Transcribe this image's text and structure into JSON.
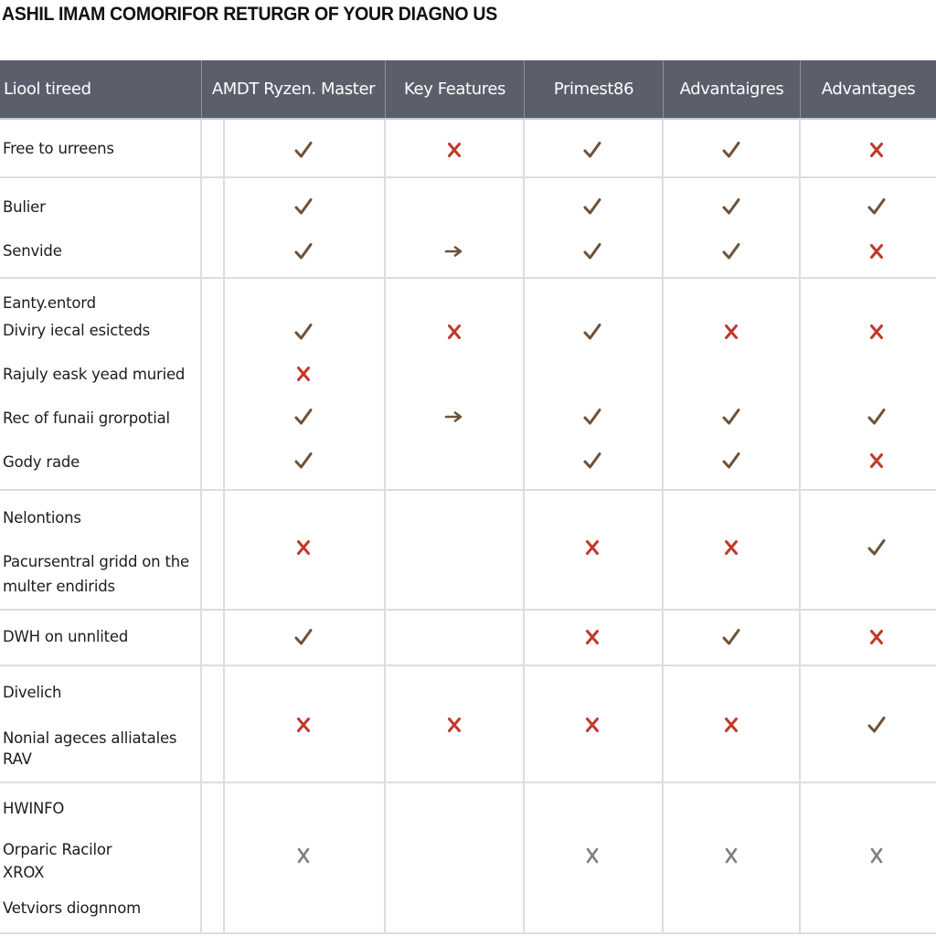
{
  "page": {
    "title": "ASHIL IMAM COMORIFOR RETURGR OF YOUR DIAGNO US"
  },
  "colors": {
    "header_bg": "#5a5f6b",
    "check": "#6e5238",
    "cross_red": "#c0392b",
    "cross_gray": "#7f7f7f",
    "arrow": "#6e5238",
    "grid_line": "#dcdde0"
  },
  "table": {
    "columns": [
      "Liool tireed",
      "AMDT Ryzen. Master",
      "Key Features",
      "Primest86",
      "Advantaigres",
      "Advantages"
    ],
    "groups": [
      {
        "labels": [
          "Free to urreens"
        ],
        "rows": [
          {
            "y": 0.5,
            "marks": [
              "check",
              "cross",
              "check",
              "check",
              "cross"
            ]
          }
        ]
      },
      {
        "labels": [
          "Bulier",
          "Senvide"
        ],
        "rows": [
          {
            "marks": [
              "check",
              "",
              "check",
              "check",
              "check"
            ]
          },
          {
            "marks": [
              "check",
              "arrow",
              "check",
              "check",
              "cross"
            ]
          }
        ]
      },
      {
        "labels": [
          "Eanty.entord",
          "Diviry iecal esicteds",
          "Rajuly eask yead muried",
          "Rec of funaii grorpotial",
          "Gody rade"
        ],
        "rows": [
          {
            "marks": [
              "check",
              "cross",
              "check",
              "cross",
              "cross"
            ]
          },
          {
            "marks": [
              "cross",
              "",
              "",
              "",
              ""
            ]
          },
          {
            "marks": [
              "check",
              "arrow",
              "check",
              "check",
              "check"
            ]
          },
          {
            "marks": [
              "check",
              "",
              "check",
              "check",
              "cross"
            ]
          }
        ]
      },
      {
        "labels": [
          "Nelontions",
          "Pacursentral gridd on the",
          "multer endirids"
        ],
        "rows": [
          {
            "marks": [
              "cross",
              "",
              "cross",
              "cross",
              "check"
            ]
          }
        ]
      },
      {
        "labels": [
          "DWH on unnlited"
        ],
        "rows": [
          {
            "marks": [
              "check",
              "",
              "cross",
              "check",
              "cross"
            ]
          }
        ]
      },
      {
        "labels": [
          "Divelich",
          "Nonial ageces alliatales",
          "RAV"
        ],
        "rows": [
          {
            "marks": [
              "cross",
              "cross",
              "cross",
              "cross",
              "check"
            ]
          }
        ]
      },
      {
        "labels": [
          "HWINFO",
          "Orparic Racilor",
          "XROX",
          "Vetviors diognnom"
        ],
        "rows": [
          {
            "marks": [
              "cross-gray",
              "",
              "cross-gray",
              "cross-gray",
              "cross-gray"
            ]
          }
        ]
      }
    ]
  }
}
